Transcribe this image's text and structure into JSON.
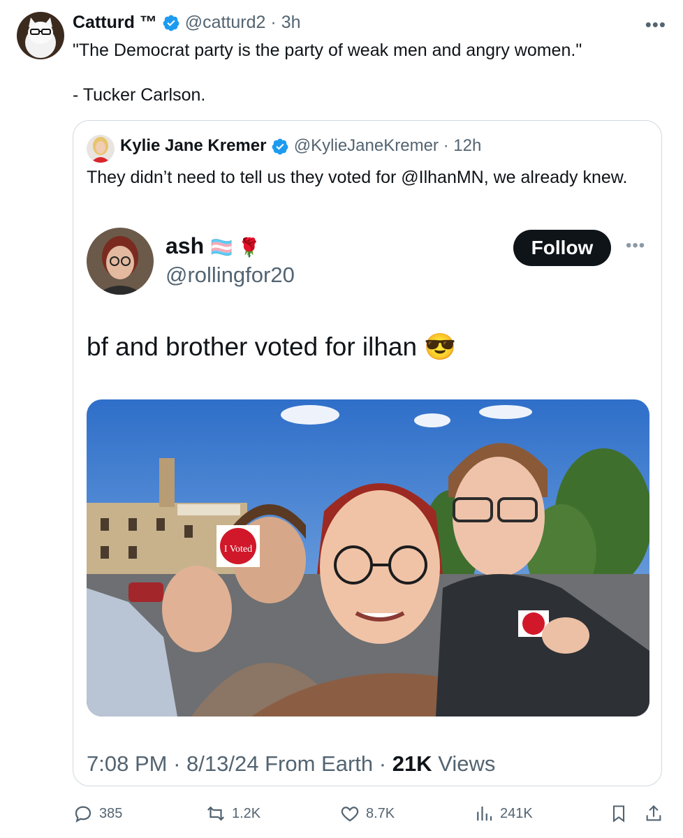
{
  "tweet": {
    "author_name": "Catturd ™",
    "handle": "@catturd2",
    "time": "3h",
    "text": "\"The Democrat party is the party of weak men and angry women.\"\n\n- Tucker Carlson."
  },
  "quote": {
    "author_name": "Kylie Jane Kremer",
    "handle": "@KylieJaneKremer",
    "time": "12h",
    "text": "They didn’t need to tell us they voted for @IlhanMN, we already knew."
  },
  "embedded": {
    "name": "ash",
    "name_emoji": "🏳️‍⚧️ 🌹",
    "handle": "@rollingfor20",
    "follow_label": "Follow",
    "text": "bf and brother voted for ilhan",
    "text_emoji": "😎",
    "time": "7:08 PM",
    "date": "8/13/24",
    "source": "From Earth",
    "views_count": "21K",
    "views_label": "Views",
    "stickers": [
      "I Voted",
      "I Voted"
    ]
  },
  "actions": {
    "replies": "385",
    "reposts": "1.2K",
    "likes": "8.7K",
    "views": "241K"
  },
  "colors": {
    "verified": "#1d9bf0",
    "text": "#0f1419",
    "muted": "#536471",
    "border": "#cfd9de"
  }
}
